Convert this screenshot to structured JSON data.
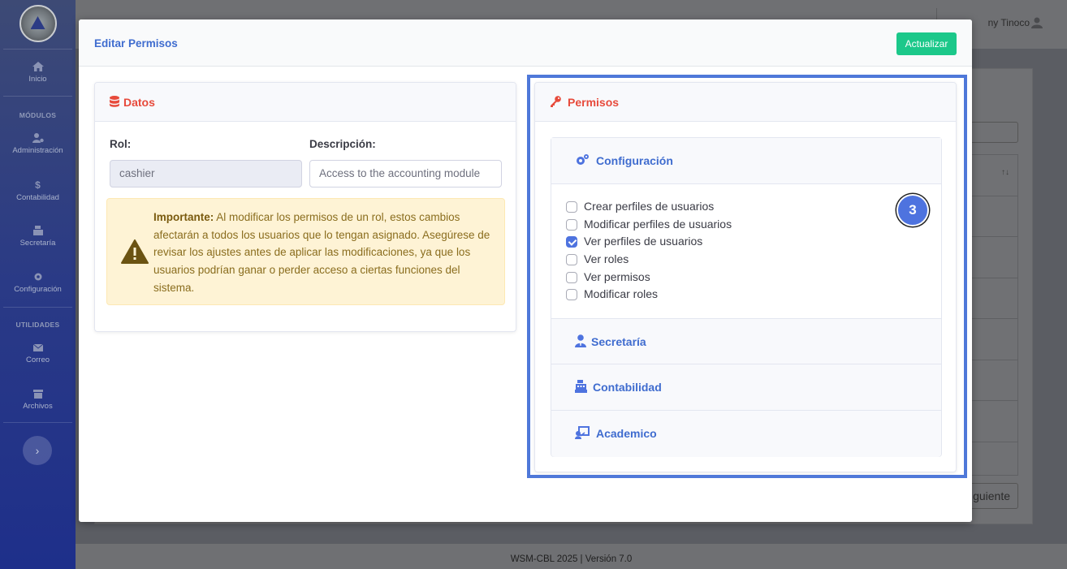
{
  "sidebar": {
    "items": [
      {
        "label": "Inicio",
        "icon": "home-icon"
      },
      {
        "label": "Administración",
        "icon": "users-cog-icon"
      },
      {
        "label": "Contabilidad",
        "icon": "dollar-icon"
      },
      {
        "label": "Secretaría",
        "icon": "cash-register-icon"
      },
      {
        "label": "Configuración",
        "icon": "gear-icon"
      },
      {
        "label": "Correo",
        "icon": "envelope-icon"
      },
      {
        "label": "Archivos",
        "icon": "archive-icon"
      }
    ],
    "section_modules": "MÓDULOS",
    "section_utilities": "UTILIDADES",
    "toggle_glyph": "›"
  },
  "topbar": {
    "user_name": "ny Tinoco"
  },
  "background": {
    "next_label": "guiente",
    "sort_glyph": "↑↓"
  },
  "footer": {
    "text": "WSM-CBL 2025 | Versión 7.0"
  },
  "modal": {
    "title": "Editar Permisos",
    "update_button": "Actualizar",
    "datos": {
      "title": "Datos",
      "rol_label": "Rol:",
      "rol_value": "cashier",
      "desc_label": "Descripción:",
      "desc_value": "Access to the accounting module",
      "alert_strong": "Importante:",
      "alert_text": " Al modificar los permisos de un rol, estos cambios afectarán a todos los usuarios que lo tengan asignado. Asegúrese de revisar los ajustes antes de aplicar las modificaciones, ya que los usuarios podrían ganar o perder acceso a ciertas funciones del sistema."
    },
    "permisos": {
      "title": "Permisos",
      "step_badge": "3",
      "sections": [
        {
          "title": "Configuración",
          "icon": "gears-icon"
        },
        {
          "title": "Secretaría",
          "icon": "user-tie-icon"
        },
        {
          "title": "Contabilidad",
          "icon": "cash-register-icon"
        },
        {
          "title": "Academico",
          "icon": "chalkboard-teacher-icon"
        }
      ],
      "options": [
        {
          "label": "Crear perfiles de usuarios",
          "checked": false
        },
        {
          "label": "Modificar perfiles de usuarios",
          "checked": false
        },
        {
          "label": "Ver perfiles de usuarios",
          "checked": true
        },
        {
          "label": "Ver roles",
          "checked": false
        },
        {
          "label": "Ver permisos",
          "checked": false
        },
        {
          "label": "Modificar roles",
          "checked": false
        }
      ]
    }
  },
  "colors": {
    "primary": "#4e73df",
    "danger": "#e74a3b",
    "success": "#1cc88a",
    "warning_bg": "#fef3d5",
    "sidebar": "#2a3a86"
  }
}
